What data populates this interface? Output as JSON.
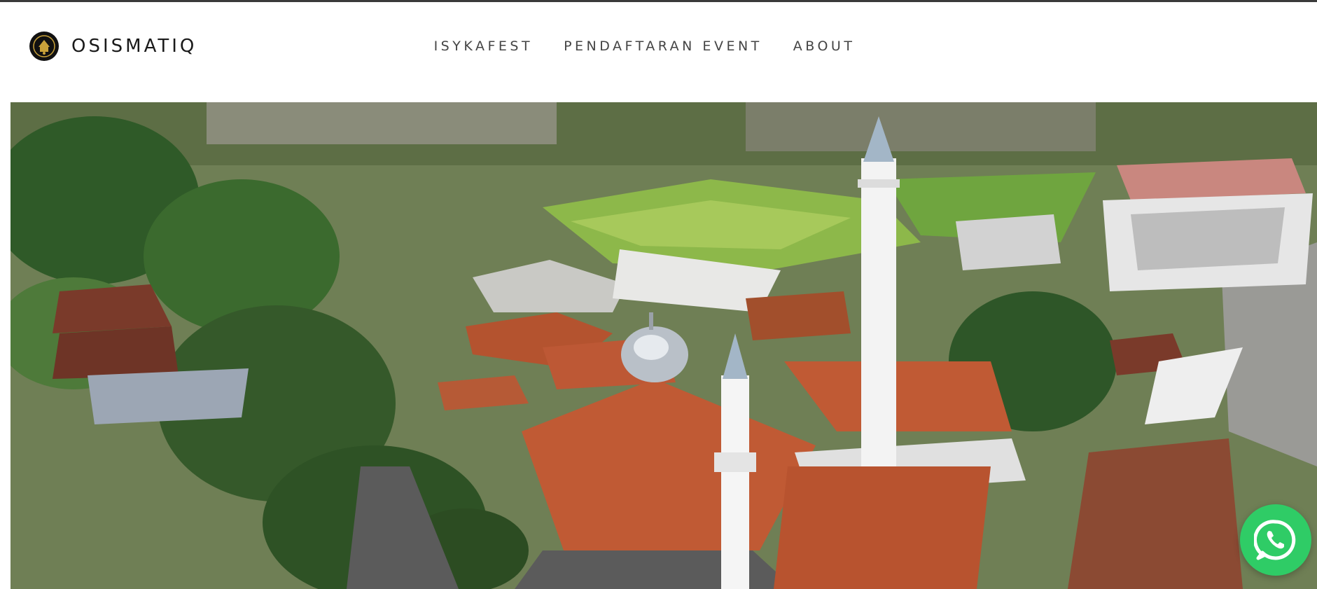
{
  "brand": {
    "name": "OSISMATIQ"
  },
  "nav": {
    "items": [
      {
        "label": "ISYKAFEST"
      },
      {
        "label": "PENDAFTARAN EVENT"
      },
      {
        "label": "ABOUT"
      }
    ]
  },
  "hero": {
    "icon": "aerial-photo-mosque-village"
  },
  "floating": {
    "icon": "whatsapp-icon",
    "color": "#2fcc66"
  }
}
